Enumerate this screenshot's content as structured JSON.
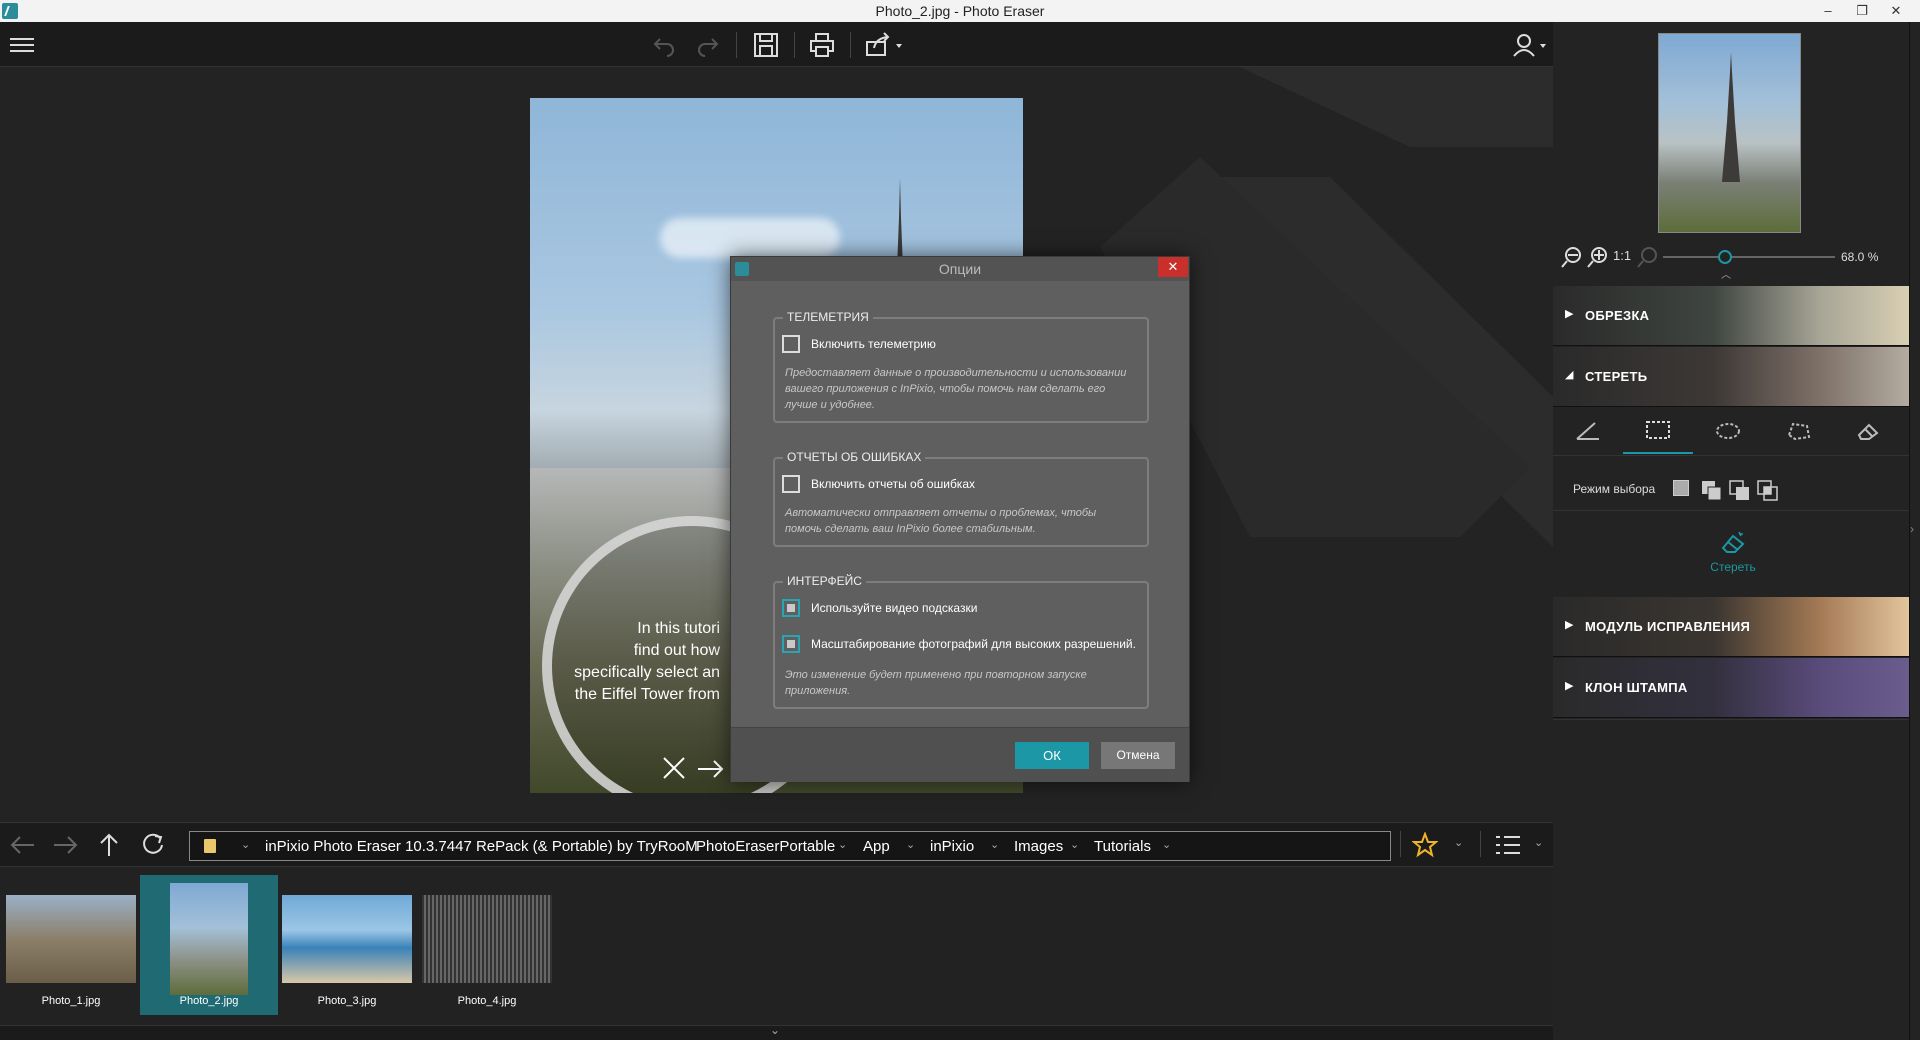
{
  "window": {
    "title": "Photo_2.jpg - Photo Eraser",
    "minimize": "–",
    "maximize": "❐",
    "close": "✕"
  },
  "toolbar": {
    "icons": [
      "menu-icon",
      "undo-icon",
      "redo-icon",
      "save-icon",
      "print-icon",
      "share-icon",
      "user-icon"
    ]
  },
  "tutorial": {
    "text": "In this tutori… find out how… specifically select an… the Eiffel Tower from…",
    "lines": [
      "In this tutori",
      "find out how",
      "specifically select an",
      "the Eiffel Tower from"
    ]
  },
  "dialog": {
    "title": "Опции",
    "close": "✕",
    "telemetry": {
      "legend": "ТЕЛЕМЕТРИЯ",
      "checkbox_label": "Включить телеметрию",
      "description": "Предоставляет данные о производительности и использовании вашего приложения с InPixio, чтобы помочь нам сделать его лучше и удобнее."
    },
    "errors": {
      "legend": "ОТЧЕТЫ ОБ ОШИБКАХ",
      "checkbox_label": "Включить отчеты об ошибках",
      "description": "Автоматически отправляет отчеты о проблемах, чтобы помочь сделать ваш InPixio более стабильным."
    },
    "interface": {
      "legend": "ИНТЕРФЕЙС",
      "video_hints": "Используйте видео подсказки",
      "hires_scaling": "Масштабирование фотографий для высоких разрешений.",
      "description": "Это изменение будет применено при повторном запуске приложения."
    },
    "ok": "ОК",
    "cancel": "Отмена"
  },
  "breadcrumb": {
    "items": [
      "inPixio Photo Eraser 10.3.7447 RePack (& Portable) by TryRooM",
      "PhotoEraserPortable",
      "App",
      "inPixio",
      "Images",
      "Tutorials"
    ]
  },
  "thumbnails": [
    {
      "name": "Photo_1.jpg",
      "selected": false
    },
    {
      "name": "Photo_2.jpg",
      "selected": true
    },
    {
      "name": "Photo_3.jpg",
      "selected": false
    },
    {
      "name": "Photo_4.jpg",
      "selected": false
    }
  ],
  "right_panel": {
    "zoom_value": "68.0 %",
    "zoom_level": 0.36,
    "sections": {
      "crop": "ОБРЕЗКА",
      "erase": "СТЕРЕТЬ",
      "fix": "МОДУЛЬ ИСПРАВЛЕНИЯ",
      "clone": "КЛОН ШТАМПА"
    },
    "selection_mode_label": "Режим выбора",
    "erase_button": "Стереть",
    "one_to_one": "1:1"
  },
  "colors": {
    "accent": "#1c97a5",
    "close_red": "#c9302c",
    "star": "#f0b429"
  }
}
